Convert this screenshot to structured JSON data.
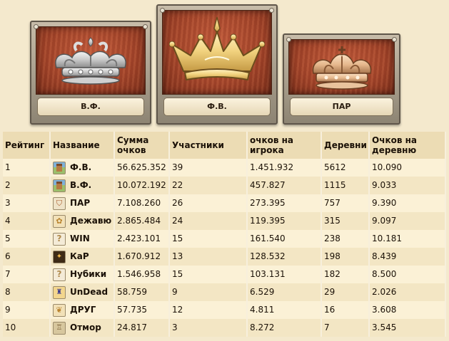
{
  "podium": [
    {
      "rank_place": 2,
      "name": "В.Ф.",
      "crown": "silver-crown-icon"
    },
    {
      "rank_place": 1,
      "name": "Ф.В.",
      "crown": "gold-crown-icon"
    },
    {
      "rank_place": 3,
      "name": "ПАР",
      "crown": "bronze-crown-icon"
    }
  ],
  "table": {
    "headers": {
      "rank": "Рейтинг",
      "name": "Название",
      "total": "Сумма очков",
      "members": "Участники",
      "per_player": "очков на игрока",
      "villages": "Деревни",
      "per_village": "Очков на деревню"
    },
    "rows": [
      {
        "rank": "1",
        "name": "Ф.В.",
        "icon": "village-icon",
        "total": "56.625.352",
        "members": "39",
        "per_player": "1.451.932",
        "villages": "5612",
        "per_village": "10.090"
      },
      {
        "rank": "2",
        "name": "В.Ф.",
        "icon": "village-icon",
        "total": "10.072.192",
        "members": "22",
        "per_player": "457.827",
        "villages": "1115",
        "per_village": "9.033"
      },
      {
        "rank": "3",
        "name": "ПАР",
        "icon": "shield-icon",
        "total": "7.108.260",
        "members": "26",
        "per_player": "273.395",
        "villages": "757",
        "per_village": "9.390"
      },
      {
        "rank": "4",
        "name": "Дежавю",
        "icon": "emblem-icon",
        "total": "2.865.484",
        "members": "24",
        "per_player": "119.395",
        "villages": "315",
        "per_village": "9.097"
      },
      {
        "rank": "5",
        "name": "WIN",
        "icon": "question-icon",
        "total": "2.423.101",
        "members": "15",
        "per_player": "161.540",
        "villages": "238",
        "per_village": "10.181"
      },
      {
        "rank": "6",
        "name": "КаР",
        "icon": "dark-emblem-icon",
        "total": "1.670.912",
        "members": "13",
        "per_player": "128.532",
        "villages": "198",
        "per_village": "8.439"
      },
      {
        "rank": "7",
        "name": "Нубики",
        "icon": "question-icon",
        "total": "1.546.958",
        "members": "15",
        "per_player": "103.131",
        "villages": "182",
        "per_village": "8.500"
      },
      {
        "rank": "8",
        "name": "UnDead",
        "icon": "crest-icon",
        "total": "58.759",
        "members": "9",
        "per_player": "6.529",
        "villages": "29",
        "per_village": "2.026"
      },
      {
        "rank": "9",
        "name": "ДРУГ",
        "icon": "emblem-icon",
        "total": "57.735",
        "members": "12",
        "per_player": "4.811",
        "villages": "16",
        "per_village": "3.608"
      },
      {
        "rank": "10",
        "name": "Отмор",
        "icon": "fortress-icon",
        "total": "24.817",
        "members": "3",
        "per_player": "8.272",
        "villages": "7",
        "per_village": "3.545"
      }
    ]
  },
  "colors": {
    "background": "#f4e9cd",
    "header": "#ecdcb4",
    "row_odd": "#fbf1d6",
    "row_even": "#f3e6c4",
    "wood": "#a6452a"
  }
}
